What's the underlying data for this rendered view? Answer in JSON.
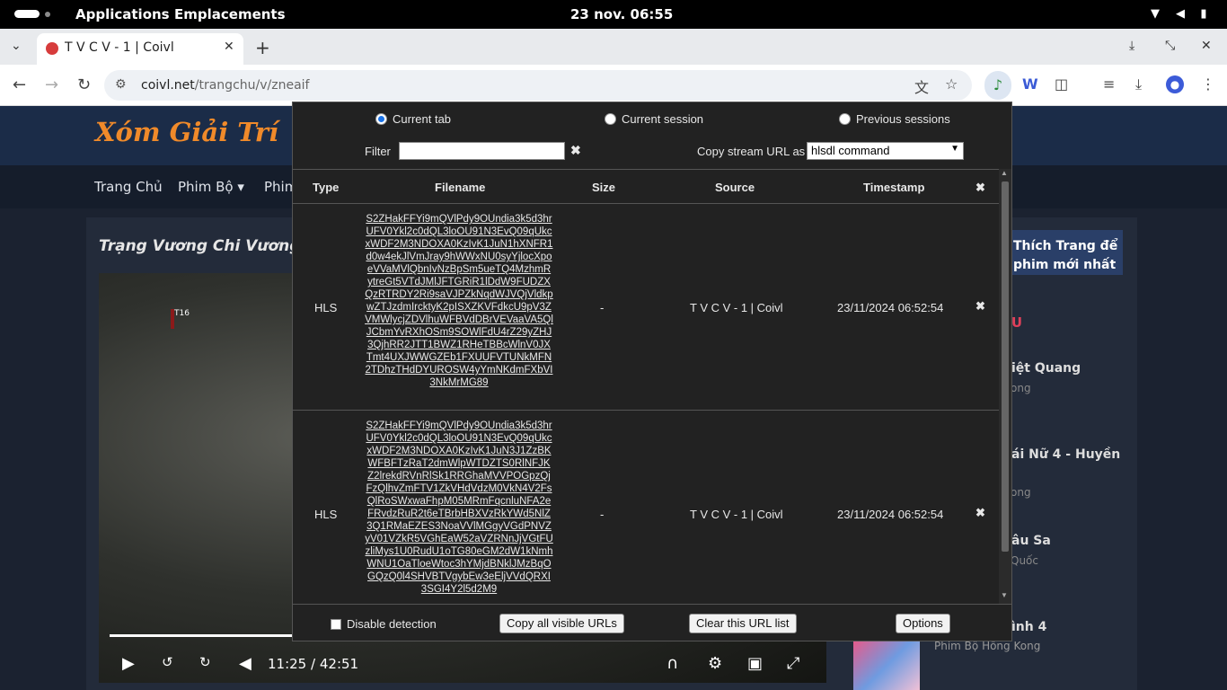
{
  "topbar": {
    "applications": "Applications",
    "places": "Emplacements",
    "clock": "23 nov.  06:55"
  },
  "browser": {
    "tab_title": "T V C V - 1 | Coivl",
    "url_domain": "coivl.net",
    "url_path": "/trangchu/v/zneaif"
  },
  "site": {
    "logo": "Xóm Giải Trí",
    "nav": [
      "Trang Chủ",
      "Phim Bộ ▾",
      "Phim"
    ],
    "movie_title": "Trạng Vương Chi Vương -",
    "video_rating": "T16",
    "video_time_current": "11:25",
    "video_time_sep": "/",
    "video_time_total": "42:51",
    "side_banner": "Thích Trang để phim mới nhất",
    "side_heading": "IỀU",
    "side_items": [
      {
        "title": "iệt Quang",
        "sub": "ong"
      },
      {
        "title": "ái Nữ 4 - Huyền",
        "sub": "ong"
      },
      {
        "title": "âu Sa",
        "sub": "Quốc"
      },
      {
        "title": "ình 4",
        "sub": "Phim Bộ Hồng Kong"
      }
    ]
  },
  "popup": {
    "radios": [
      {
        "label": "Current tab",
        "checked": true
      },
      {
        "label": "Current session",
        "checked": false
      },
      {
        "label": "Previous sessions",
        "checked": false
      }
    ],
    "filter_label": "Filter",
    "filter_value": "",
    "filter_clear": "✖",
    "copy_as_label": "Copy stream URL as",
    "copy_as_value": "hlsdl command",
    "columns": [
      "Type",
      "Filename",
      "Size",
      "Source",
      "Timestamp",
      "✖"
    ],
    "rows": [
      {
        "type": "HLS",
        "filename": "S2ZHakFFYi9mQVlPdy9OUndia3k5d3hrUFV0Ykl2c0dQL3loOU91N3EvQ09qUkcxWDF2M3NDOXA0KzIvK1JuN1hXNFR1d0w4ekJlVmJray9hWWxNU0syYjlocXpoeVVaMVlQbnIvNzBpSm5ueTQ4MzhmRytreGt5VTdJMlJFTGRiR1lDdW9FUDZXQzRTRDY2Ri9saVJPZkNqdWJVQjVldkpwZTJzdmIrcktyK2pISXZKVFdkcU9pV3ZVMWlycjZDVlhuWFBVdDBrVEVaaVA5QlJCbmYvRXhOSm9SOWlFdU4rZ29yZHJ3QjhRR2JTT1BWZ1RHeTBBcWlnV0JXTmt4UXJWWGZEb1FXUUFVTUNkMFN2TDhzTHdDYUROSW4yYmNKdmFXbVI3NkMrMG89",
        "size": "-",
        "source": "T V C V - 1 | Coivl",
        "timestamp": "23/11/2024 06:52:54"
      },
      {
        "type": "HLS",
        "filename": "S2ZHakFFYi9mQVlPdy9OUndia3k5d3hrUFV0Ykl2c0dQL3loOU91N3EvQ09qUkcxWDF2M3NDOXA0KzIvK1JuN3J1ZzBKWFBFTzRaT2dmWlpWTDZTS0RlNFJKZ2lrekdRVnRlSk1RRGhaMVVPOGpzQjFzQlhvZmFTV1ZkVHdVdzM0VkN4V2FsQlRoSWxwaFhpM05MRmFqcnluNFA2eFRvdzRuR2t6eTBrbHBXVzRkYWd5NlZ3Q1RMaEZES3NoaVVlMGgyVGdPNVZyV01VZkR5VGhEaW52aVZRNnJjVGtFUzliMys1U0RudU1oTG80eGM2dW1kNmhWNU1OaTloeWtoc3hYMjdBNklJMzBqOGQzQ0l4SHVBTVgybEw3eEljVVdQRXI3SGI4Y2l5d2M9",
        "size": "-",
        "source": "T V C V - 1 | Coivl",
        "timestamp": "23/11/2024 06:52:54"
      }
    ],
    "row_delete": "✖",
    "footer": {
      "disable_detection": "Disable detection",
      "copy_all": "Copy all visible URLs",
      "clear_list": "Clear this URL list",
      "options": "Options"
    }
  }
}
